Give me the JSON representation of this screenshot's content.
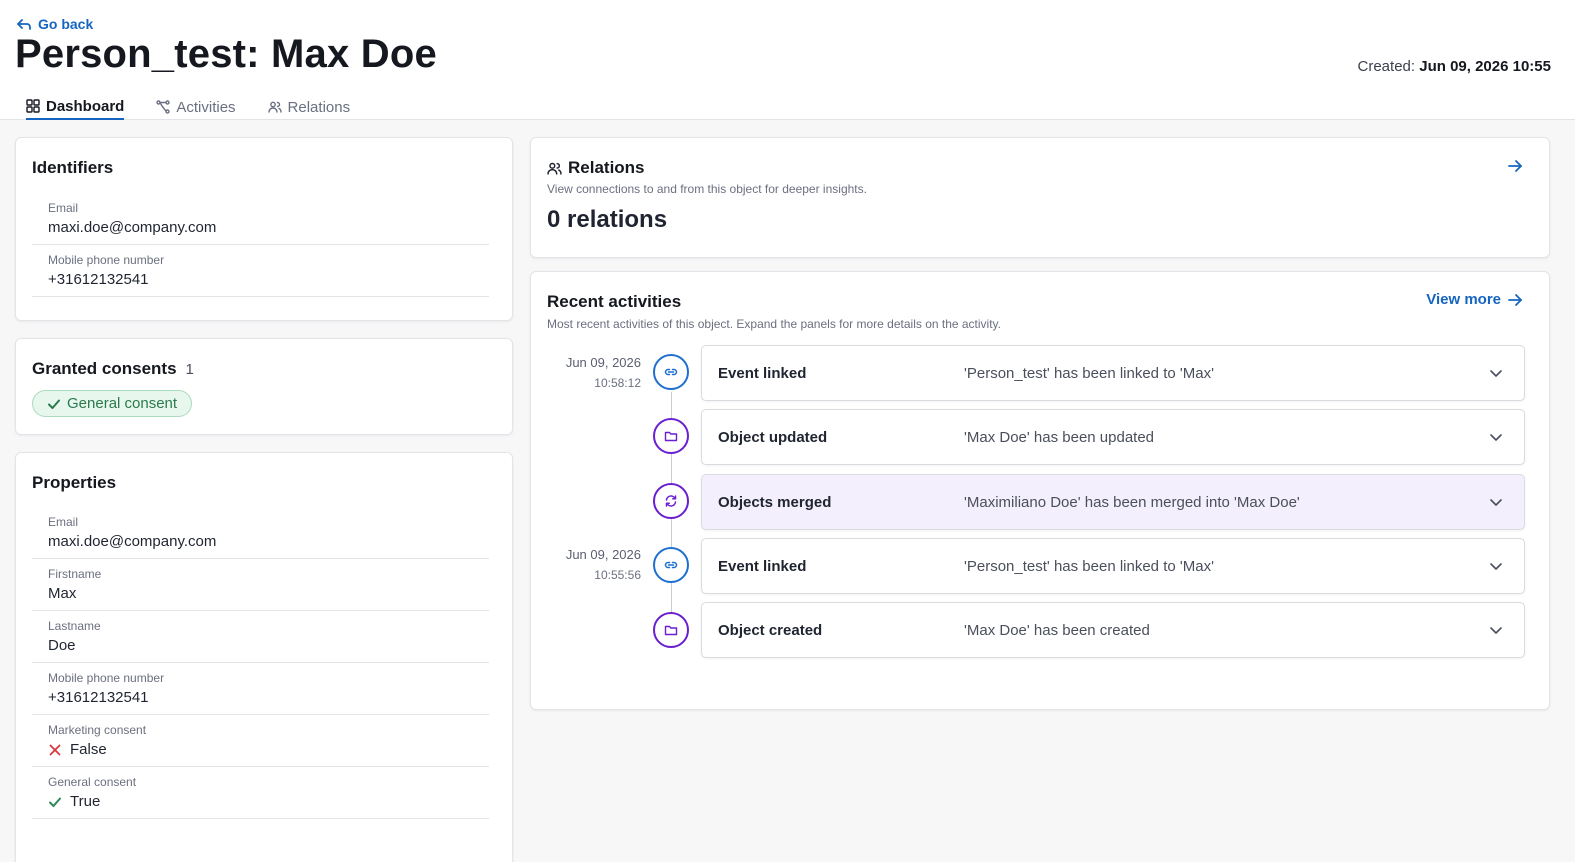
{
  "header": {
    "go_back": "Go back",
    "title": "Person_test: Max Doe",
    "created_label": "Created:",
    "created_value": "Jun 09, 2026 10:55"
  },
  "tabs": [
    {
      "label": "Dashboard",
      "icon": "grid-icon",
      "active": true
    },
    {
      "label": "Activities",
      "icon": "flow-icon",
      "active": false
    },
    {
      "label": "Relations",
      "icon": "users-icon",
      "active": false
    }
  ],
  "identifiers": {
    "title": "Identifiers",
    "fields": [
      {
        "label": "Email",
        "value": "maxi.doe@company.com"
      },
      {
        "label": "Mobile phone number",
        "value": "+31612132541"
      }
    ]
  },
  "consents": {
    "title": "Granted consents",
    "count": "1",
    "chip": "General consent"
  },
  "properties": {
    "title": "Properties",
    "fields": [
      {
        "label": "Email",
        "value": "maxi.doe@company.com"
      },
      {
        "label": "Firstname",
        "value": "Max"
      },
      {
        "label": "Lastname",
        "value": "Doe"
      },
      {
        "label": "Mobile phone number",
        "value": "+31612132541"
      },
      {
        "label": "Marketing consent",
        "value": "False",
        "icon": "cross-icon"
      },
      {
        "label": "General consent",
        "value": "True",
        "icon": "check-icon"
      }
    ]
  },
  "relations": {
    "title": "Relations",
    "subtitle": "View connections to and from this object for deeper insights.",
    "count_text": "0 relations"
  },
  "recent": {
    "title": "Recent activities",
    "subtitle": "Most recent activities of this object. Expand the panels for more details on the activity.",
    "view_more": "View more",
    "groups": [
      {
        "date": "Jun 09, 2026",
        "time": "10:58:12"
      },
      {
        "date": "Jun 09, 2026",
        "time": "10:55:56"
      }
    ],
    "items": [
      {
        "type": "Event linked",
        "desc": "'Person_test' has been linked to 'Max'",
        "icon": "link-icon",
        "color": "#1e6fd0"
      },
      {
        "type": "Object updated",
        "desc": "'Max Doe' has been updated",
        "icon": "folder-icon",
        "color": "#6a1fd0"
      },
      {
        "type": "Objects merged",
        "desc": "'Maximiliano Doe' has been merged into 'Max Doe'",
        "icon": "merge-icon",
        "color": "#6a1fd0"
      },
      {
        "type": "Event linked",
        "desc": "'Person_test' has been linked to 'Max'",
        "icon": "link-icon",
        "color": "#1e6fd0"
      },
      {
        "type": "Object created",
        "desc": "'Max Doe' has been created",
        "icon": "folder-icon",
        "color": "#6a1fd0"
      }
    ]
  }
}
